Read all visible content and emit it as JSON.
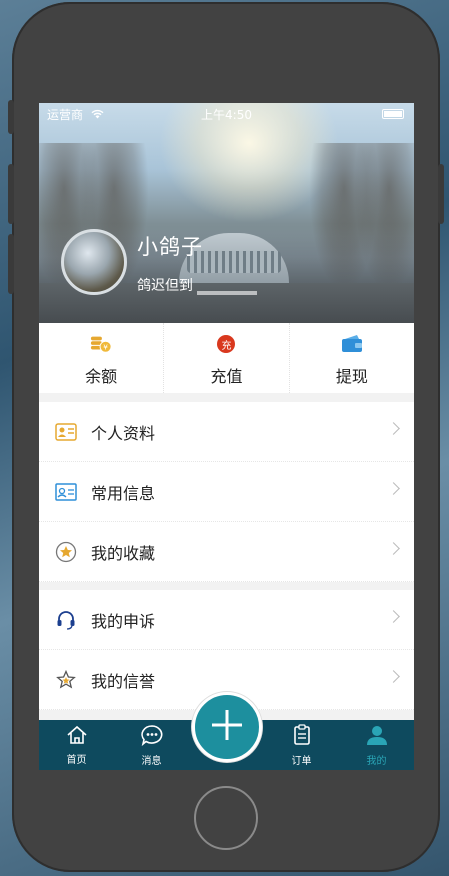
{
  "status_bar": {
    "carrier": "运营商",
    "time": "上午4:50"
  },
  "profile": {
    "name": "小鸽子",
    "signature": "鸽迟但到"
  },
  "wallet": [
    {
      "label": "余额",
      "icon": "coins-icon",
      "color": "#e6a830"
    },
    {
      "label": "充值",
      "icon": "recharge-icon",
      "badge": "充",
      "color": "#d9381e"
    },
    {
      "label": "提现",
      "icon": "wallet-icon",
      "color": "#2f8fd8"
    }
  ],
  "menu_group1": [
    {
      "label": "个人资料",
      "icon": "profile-card-icon"
    },
    {
      "label": "常用信息",
      "icon": "id-card-icon"
    },
    {
      "label": "我的收藏",
      "icon": "favorite-star-icon"
    }
  ],
  "menu_group2": [
    {
      "label": "我的申诉",
      "icon": "headset-icon"
    },
    {
      "label": "我的信誉",
      "icon": "star-outline-icon"
    }
  ],
  "tabbar": {
    "items": [
      {
        "label": "首页",
        "icon": "home-icon"
      },
      {
        "label": "消息",
        "icon": "chat-icon"
      },
      {
        "label": "订单",
        "icon": "order-icon"
      },
      {
        "label": "我的",
        "icon": "user-icon"
      }
    ],
    "active": "我的",
    "colors": {
      "background": "#0e4a5e",
      "active": "#2aa5b6",
      "plus": "#1d8f9e"
    }
  }
}
